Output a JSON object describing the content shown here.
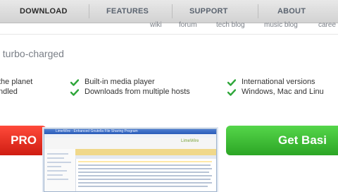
{
  "nav": {
    "tabs": [
      "DOWNLOAD",
      "FEATURES",
      "SUPPORT",
      "ABOUT"
    ],
    "active_tab": "DOWNLOAD"
  },
  "subnav": [
    "wiki",
    "forum",
    "tech blog",
    "music blog",
    "caree"
  ],
  "tagline": "t turbo-charged",
  "features": {
    "col1": [
      "the planet",
      "ndled"
    ],
    "col2": [
      "Built-in media player",
      "Downloads from multiple hosts"
    ],
    "col3": [
      "International versions",
      "Windows, Mac and Linu"
    ]
  },
  "buttons": {
    "pro": "PRO",
    "basic": "Get Basi"
  },
  "screenshot": {
    "title": "LimeWire - Enhanced Gnutella File Sharing Program",
    "logo": "LimeWire"
  },
  "colors": {
    "check": "#2ea63a",
    "pro_button": "#e02a1c",
    "basic_button": "#3fc034",
    "nav_text": "#5b6470"
  }
}
